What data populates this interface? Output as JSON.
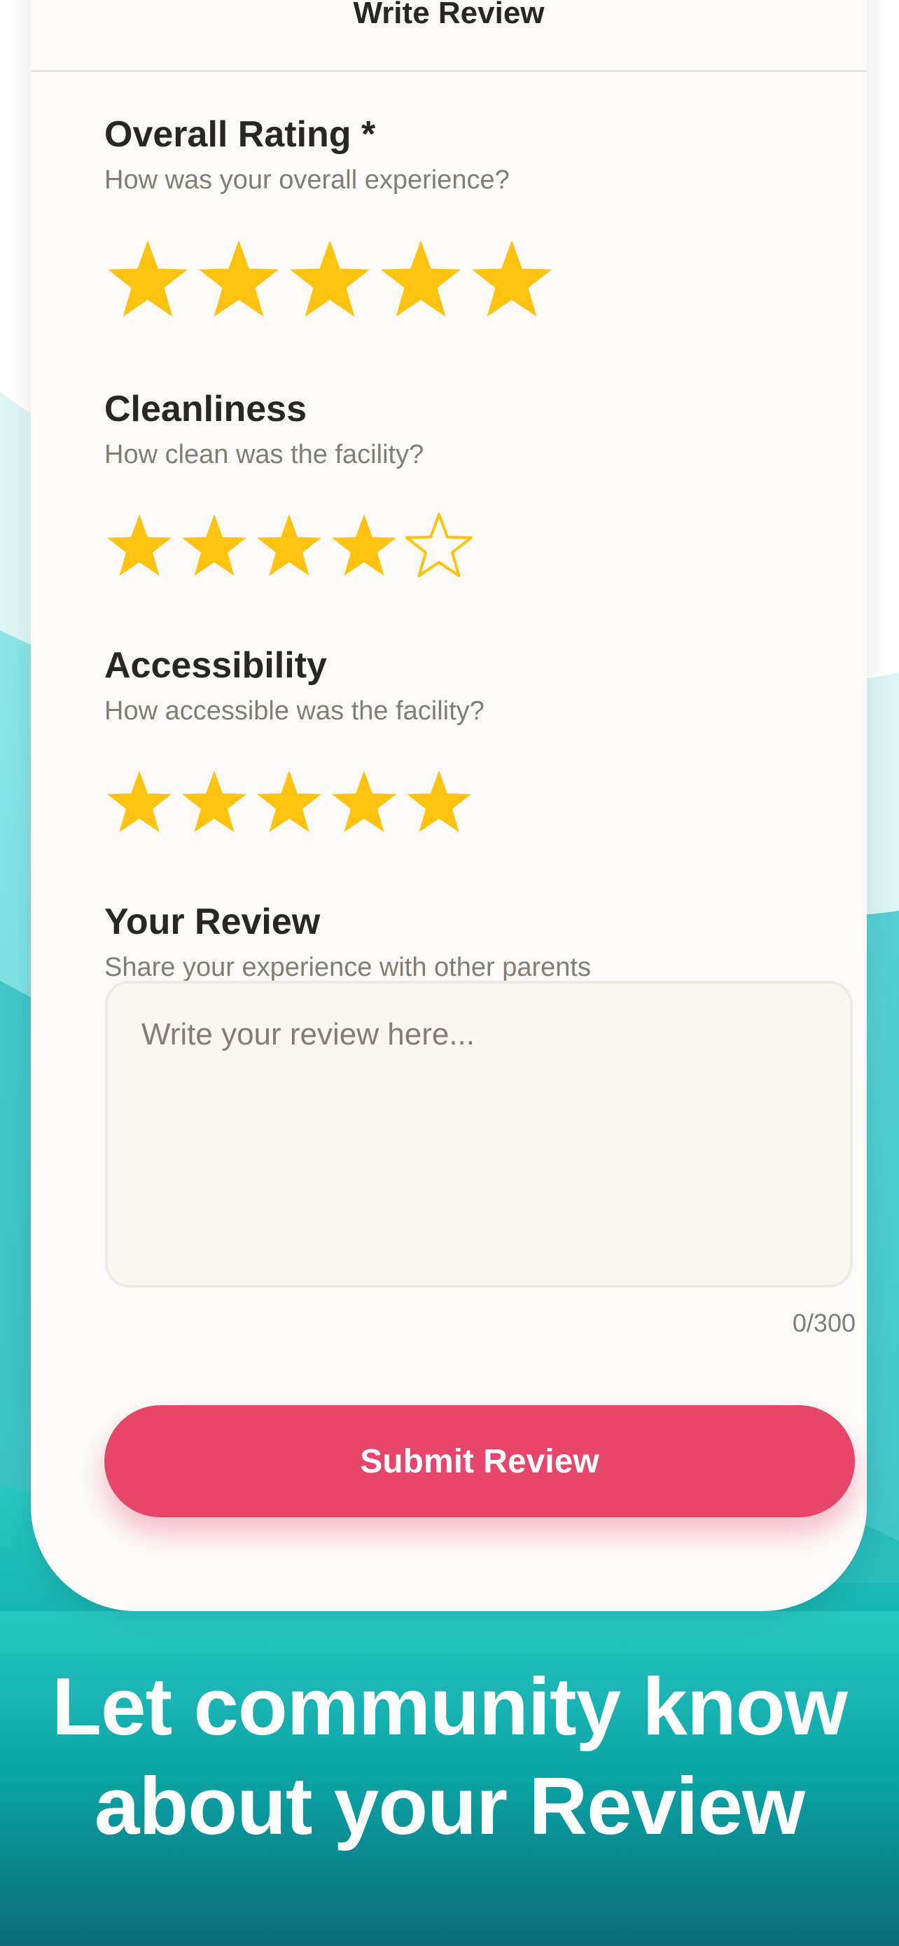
{
  "header": {
    "title": "Write Review"
  },
  "ratings": [
    {
      "title": "Overall Rating *",
      "subtitle": "How was your overall experience?",
      "value": 5,
      "max": 5
    },
    {
      "title": "Cleanliness",
      "subtitle": "How clean was the facility?",
      "value": 4,
      "max": 5
    },
    {
      "title": "Accessibility",
      "subtitle": "How accessible was the facility?",
      "value": 5,
      "max": 5
    }
  ],
  "review": {
    "title": "Your Review",
    "subtitle": "Share your experience with other parents",
    "placeholder": "Write your review here...",
    "value": "",
    "char_count": "0/300"
  },
  "submit": {
    "label": "Submit Review"
  },
  "promo": {
    "line1": "Let community know",
    "line2": "about your Review"
  },
  "colors": {
    "star": "#fec20f",
    "accent": "#e8456b",
    "teal": "#0aa9a6",
    "teal_dark": "#0b6f7d"
  },
  "icons": {
    "star_filled": "star-filled-icon",
    "star_empty": "star-outline-icon"
  }
}
